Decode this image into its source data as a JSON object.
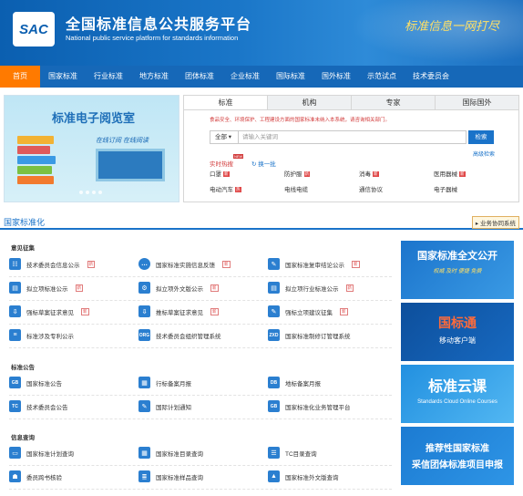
{
  "header": {
    "logo_text": "SAC",
    "title": "全国标准信息公共服务平台",
    "subtitle": "National public service platform  for standards information",
    "slogan": "标准信息一网打尽"
  },
  "nav": {
    "items": [
      "首页",
      "国家标准",
      "行业标准",
      "地方标准",
      "团体标准",
      "企业标准",
      "国际标准",
      "国外标准",
      "示范试点",
      "技术委员会"
    ]
  },
  "banner": {
    "title": "标准电子阅览室",
    "subtitle": "在线订阅  在线阅读"
  },
  "search": {
    "tabs": [
      "标准",
      "机构",
      "专家",
      "国际国外"
    ],
    "notice": "食品安全、环境保护、工程建设方面的国家标准未纳入本系统，请咨询相关部门。",
    "select": "全部 ▾",
    "placeholder": "请输入关键词",
    "button": "检索",
    "advanced": "高级检索",
    "hot_label": "实时热搜",
    "hot_badge": "NEW",
    "refresh": "换一批",
    "hot_items": [
      {
        "label": "口罩",
        "badge": "新"
      },
      {
        "label": "防护服",
        "badge": "新"
      },
      {
        "label": "消毒",
        "badge": "新"
      },
      {
        "label": "医用器械",
        "badge": "新"
      },
      {
        "label": "电动汽车",
        "badge": "热"
      },
      {
        "label": "电线电缆",
        "badge": ""
      },
      {
        "label": "通信协议",
        "badge": ""
      },
      {
        "label": "电子器械",
        "badge": ""
      }
    ]
  },
  "section": {
    "title": "国家标准化",
    "cooperate": "业务协同系统"
  },
  "groups": {
    "opinion": "意见征集",
    "announce": "标准公告",
    "query": "信息查询"
  },
  "services": {
    "r1": [
      "技术委员会信息公示",
      "国家标准实施信息反馈",
      "国家标准复审结论公示"
    ],
    "r2": [
      "拟立项标准公示",
      "拟立项外文版公示",
      "拟立项行业标准公示"
    ],
    "r3": [
      "强标草案征求意见",
      "推标草案征求意见",
      "强标立项建议征集"
    ],
    "r4": [
      "标准涉及专利公示",
      "技术委员会组织管理系统",
      "国家标准制修订管理系统"
    ],
    "r5": [
      "国家标准公告",
      "行标备案月报",
      "地标备案月报"
    ],
    "r6": [
      "技术委员会公告",
      "国际计划通知",
      "国家标准化业务管理平台"
    ],
    "r7": [
      "国家标准计划查询",
      "国家标准目录查询",
      "TC目录查询"
    ],
    "r8": [
      "委员跨书核验",
      "国家标准样品查询",
      "国家标准外文版查询"
    ],
    "badge": "新"
  },
  "ads": {
    "a1_title": "国家标准全文公开",
    "a1_sub": "权威  及时  便捷  免费",
    "a2_title": "国标通",
    "a2_sub": "移动客户端",
    "a3_title": "标准云课",
    "a3_sub": "Standards Cloud Online Courses",
    "a4_title": "推荐性国家标准",
    "a4_sub": "采信团体标准项目申报"
  }
}
